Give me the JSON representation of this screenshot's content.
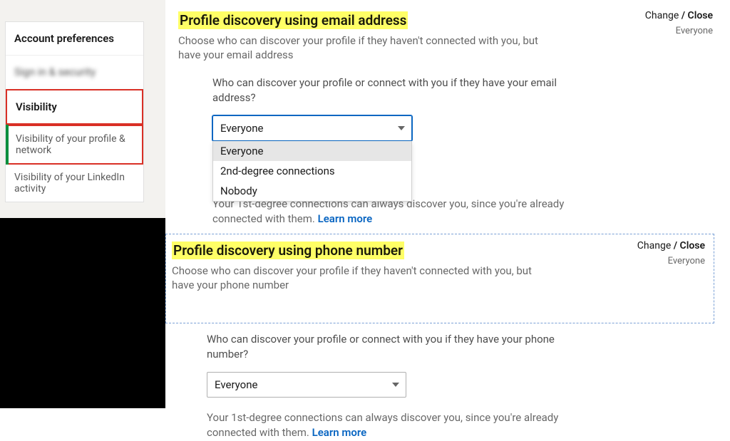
{
  "sidebar": {
    "items": [
      {
        "label": "Account preferences"
      },
      {
        "label": "Sign in & security"
      },
      {
        "label": "Visibility"
      }
    ],
    "sub": [
      {
        "label": "Visibility of your profile & network"
      },
      {
        "label": "Visibility of your LinkedIn activity"
      }
    ]
  },
  "section1": {
    "title": "Profile discovery using email address",
    "desc": "Choose who can discover your profile if they haven't connected with you, but have your email address",
    "change": "Change",
    "slash": " / ",
    "close": "Close",
    "status": "Everyone",
    "question": "Who can discover your profile or connect with you if they have your email address?",
    "selected": "Everyone",
    "options": [
      "Everyone",
      "2nd-degree connections",
      "Nobody"
    ],
    "note_pre": "Your 1st-degree connections can always discover you, since you're already connected with them. ",
    "learn": "Learn more"
  },
  "section2": {
    "title": "Profile discovery using phone number",
    "desc": "Choose who can discover your profile if they haven't connected with you, but have your phone number",
    "change": "Change",
    "slash": " / ",
    "close": "Close",
    "status": "Everyone",
    "question": "Who can discover your profile or connect with you if they have your phone number?",
    "selected": "Everyone",
    "note_pre": "Your 1st-degree connections can always discover you, since you're already connected with them. ",
    "learn": "Learn more"
  }
}
